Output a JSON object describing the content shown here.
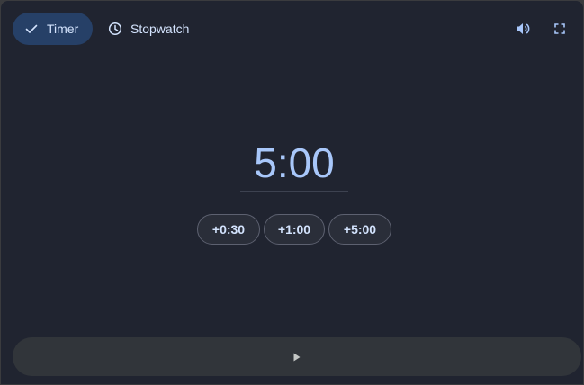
{
  "tabs": {
    "timer": {
      "label": "Timer",
      "icon": "check-icon",
      "selected": true
    },
    "stopwatch": {
      "label": "Stopwatch",
      "icon": "clock-icon",
      "selected": false
    }
  },
  "toolbar": {
    "volume_icon": "volume-icon",
    "fullscreen_icon": "fullscreen-icon"
  },
  "timer": {
    "display": "5:00"
  },
  "quick_add": [
    {
      "label": "+0:30"
    },
    {
      "label": "+1:00"
    },
    {
      "label": "+5:00"
    }
  ],
  "controls": {
    "play_icon": "play-icon"
  },
  "colors": {
    "background": "#202430",
    "accent": "#a8c7fa",
    "selected_tab": "#264067",
    "play_bar": "#31353a"
  }
}
